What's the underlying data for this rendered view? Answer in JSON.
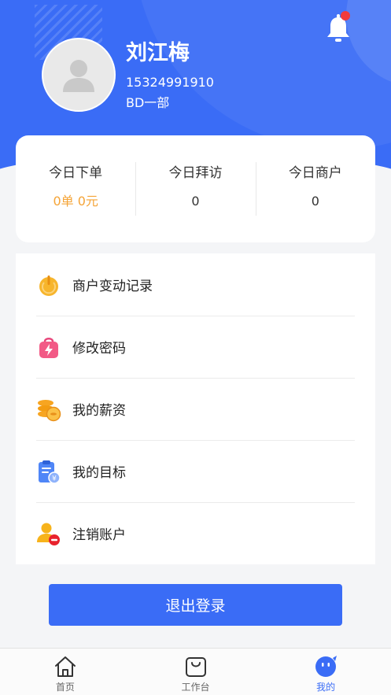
{
  "profile": {
    "name": "刘江梅",
    "phone": "15324991910",
    "department": "BD一部"
  },
  "notification": {
    "icon": "bell-icon",
    "has_unread": true
  },
  "stats": [
    {
      "label": "今日下单",
      "value": "0单 0元"
    },
    {
      "label": "今日拜访",
      "value": "0"
    },
    {
      "label": "今日商户",
      "value": "0"
    }
  ],
  "menu": {
    "items": [
      {
        "label": "商户变动记录",
        "icon": "power-icon"
      },
      {
        "label": "修改密码",
        "icon": "lightning-bag-icon"
      },
      {
        "label": "我的薪资",
        "icon": "coins-icon"
      },
      {
        "label": "我的目标",
        "icon": "clipboard-icon"
      },
      {
        "label": "注销账户",
        "icon": "user-remove-icon"
      }
    ]
  },
  "logout_label": "退出登录",
  "tabbar": {
    "tabs": [
      {
        "label": "首页",
        "icon": "home-icon"
      },
      {
        "label": "工作台",
        "icon": "bag-icon"
      },
      {
        "label": "我的",
        "icon": "chat-face-icon",
        "active": true
      }
    ]
  },
  "colors": {
    "primary": "#3a6cf6",
    "accent_orange": "#f5a437",
    "badge_red": "#f23b3b"
  }
}
